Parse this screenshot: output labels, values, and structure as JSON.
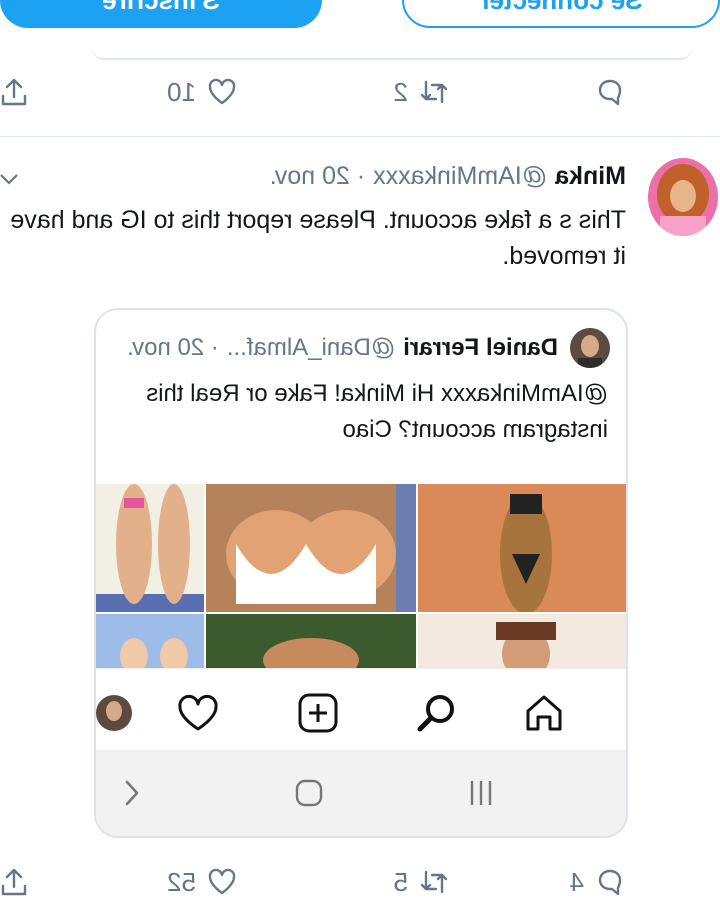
{
  "header": {
    "login_label": "Se connecter",
    "signup_label": "S'inscrire"
  },
  "top_actions": {
    "retweets": "2",
    "likes": "10"
  },
  "tweet": {
    "author_name": "Minka",
    "author_handle": "@IAmMinkaxxx",
    "date": "· 20 nov.",
    "text": "This s a fake account. Please report this to IG and have it removed.",
    "actions": {
      "replies": "4",
      "retweets": "5",
      "likes": "52"
    }
  },
  "embedded": {
    "author_name": "Daniel Ferrari",
    "author_handle": "@Dani_Almaf...",
    "date": "· 20 nov.",
    "text": "@IAmMinkaxxx Hi Minka! Fake or Real this instagram account? Ciao"
  },
  "instagram_nav": [
    "home-icon",
    "search-icon",
    "add-icon",
    "heart-icon",
    "profile-icon"
  ],
  "android_nav": [
    "recent-apps-icon",
    "home-icon",
    "back-icon"
  ],
  "colors": {
    "accent": "#1da1f2",
    "muted": "#657786",
    "divider": "#e1e8ed"
  }
}
